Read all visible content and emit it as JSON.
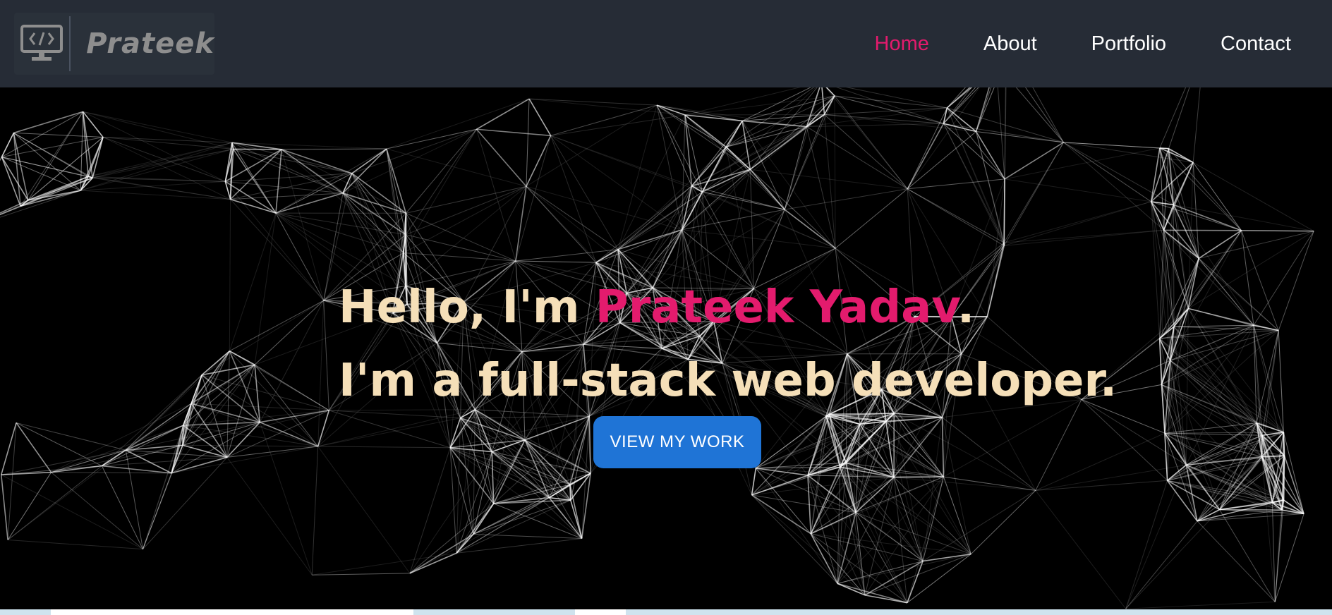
{
  "navbar": {
    "brand": {
      "name": "Prateek",
      "icon": "code-monitor-icon"
    },
    "links": [
      {
        "label": "Home",
        "active": true
      },
      {
        "label": "About",
        "active": false
      },
      {
        "label": "Portfolio",
        "active": false
      },
      {
        "label": "Contact",
        "active": false
      }
    ]
  },
  "hero": {
    "greeting": "Hello, I'm ",
    "name": "Prateek Yadav",
    "greeting_end": ".",
    "tagline": "I'm a full-stack web developer.",
    "cta_label": "VIEW MY WORK",
    "background": "particle-network"
  },
  "colors": {
    "accent": "#e31b6d",
    "text": "#f5dfb8",
    "nav_bg": "#262c36",
    "button": "#1f74d6"
  }
}
